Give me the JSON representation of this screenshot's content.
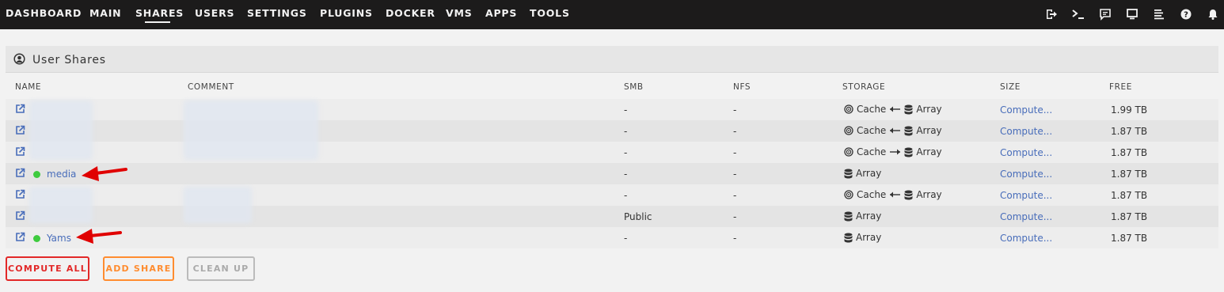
{
  "nav": {
    "items": [
      "DASHBOARD",
      "MAIN",
      "SHARES",
      "USERS",
      "SETTINGS",
      "PLUGINS",
      "DOCKER",
      "VMS",
      "APPS",
      "TOOLS"
    ],
    "active": "SHARES"
  },
  "panel": {
    "title": "User Shares"
  },
  "columns": {
    "name": "NAME",
    "comment": "COMMENT",
    "smb": "SMB",
    "nfs": "NFS",
    "storage": "STORAGE",
    "size": "SIZE",
    "free": "FREE"
  },
  "rows": [
    {
      "name": "",
      "smb": "-",
      "nfs": "-",
      "storage_cache": "Cache",
      "storage_array": "Array",
      "direction": "left",
      "size": "Compute...",
      "free": "1.99 TB"
    },
    {
      "name": "",
      "smb": "-",
      "nfs": "-",
      "storage_cache": "Cache",
      "storage_array": "Array",
      "direction": "left",
      "size": "Compute...",
      "free": "1.87 TB"
    },
    {
      "name": "",
      "smb": "-",
      "nfs": "-",
      "storage_cache": "Cache",
      "storage_array": "Array",
      "direction": "right",
      "size": "Compute...",
      "free": "1.87 TB"
    },
    {
      "name": "media",
      "smb": "-",
      "nfs": "-",
      "storage_cache": "",
      "storage_array": "Array",
      "direction": "none",
      "size": "Compute...",
      "free": "1.87 TB"
    },
    {
      "name": "",
      "smb": "-",
      "nfs": "-",
      "storage_cache": "Cache",
      "storage_array": "Array",
      "direction": "left",
      "size": "Compute...",
      "free": "1.87 TB"
    },
    {
      "name": "",
      "smb": "Public",
      "nfs": "-",
      "storage_cache": "",
      "storage_array": "Array",
      "direction": "none",
      "size": "Compute...",
      "free": "1.87 TB"
    },
    {
      "name": "Yams",
      "smb": "-",
      "nfs": "-",
      "storage_cache": "",
      "storage_array": "Array",
      "direction": "none",
      "size": "Compute...",
      "free": "1.87 TB"
    }
  ],
  "buttons": {
    "compute_all": "COMPUTE ALL",
    "add_share": "ADD SHARE",
    "clean_up": "CLEAN UP"
  },
  "colors": {
    "topbar": "#1c1b1b",
    "link": "#486dba",
    "status_green": "#3ecb3e",
    "annotation_red": "#e00000",
    "compute_border": "#e22828",
    "add_border": "#ff8c2f"
  },
  "icons": [
    "logout-icon",
    "terminal-icon",
    "feedback-icon",
    "monitor-icon",
    "log-icon",
    "help-icon",
    "bell-icon"
  ]
}
